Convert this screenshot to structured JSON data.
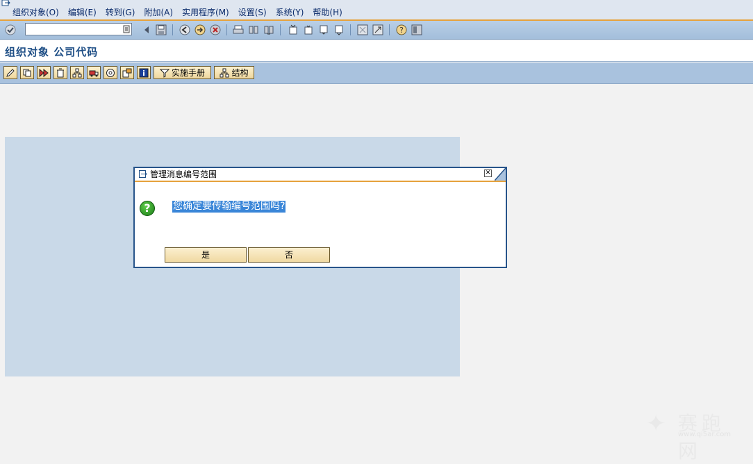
{
  "menubar": {
    "items": [
      "组织对象(O)",
      "编辑(E)",
      "转到(G)",
      "附加(A)",
      "实用程序(M)",
      "设置(S)",
      "系统(Y)",
      "帮助(H)"
    ]
  },
  "toolbar": {
    "command_field_value": ""
  },
  "title": "组织对象 公司代码",
  "app_toolbar": {
    "impl_guide_label": "实施手册",
    "structure_label": "结构"
  },
  "dialog": {
    "title": "管理消息编号范围",
    "message": "您确定要传输编号范围吗?",
    "yes_label": "是",
    "no_label": "否"
  },
  "watermark": {
    "text": "赛跑网",
    "url": "www.qi5ar.com"
  },
  "colors": {
    "menubar_bg": "#dfe6f0",
    "toolbar_bg": "#a9c2de",
    "accent_orange": "#e6a23c",
    "panel_bg": "#c9d9e8",
    "dialog_border": "#27548a",
    "selection_blue": "#3a86d8",
    "button_bg": "#f0d9a2"
  }
}
